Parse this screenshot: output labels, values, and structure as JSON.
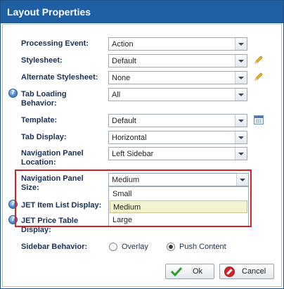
{
  "dialog": {
    "title": "Layout Properties"
  },
  "fields": {
    "processing_event": {
      "label": "Processing Event:",
      "value": "Action"
    },
    "stylesheet": {
      "label": "Stylesheet:",
      "value": "Default"
    },
    "alternate_stylesheet": {
      "label": "Alternate Stylesheet:",
      "value": "None"
    },
    "tab_loading_behavior": {
      "label_line1": "Tab Loading",
      "label_line2": "Behavior:",
      "value": "All"
    },
    "template": {
      "label": "Template:",
      "value": "Default"
    },
    "tab_display": {
      "label": "Tab Display:",
      "value": "Horizontal"
    },
    "navigation_panel_location": {
      "label_line1": "Navigation Panel",
      "label_line2": "Location:",
      "value": "Left Sidebar"
    },
    "navigation_panel_size": {
      "label_line1": "Navigation Panel",
      "label_line2": "Size:",
      "value": "Medium",
      "options": [
        "Small",
        "Medium",
        "Large"
      ],
      "highlighted_option": "Medium"
    },
    "jet_item_list_display": {
      "label": "JET Item List Display:"
    },
    "jet_price_table_display": {
      "label_line1": "JET Price Table",
      "label_line2": "Display:"
    },
    "sidebar_behavior": {
      "label": "Sidebar Behavior:",
      "options": [
        "Overlay",
        "Push Content"
      ],
      "selected": "Push Content"
    }
  },
  "buttons": {
    "ok": "Ok",
    "cancel": "Cancel"
  },
  "icons": {
    "help": "help-icon",
    "edit": "pencil-icon",
    "template_picker": "calendar-icon",
    "ok": "checkmark-icon",
    "cancel": "cancel-icon"
  },
  "colors": {
    "titlebar": "#1f5fa3",
    "highlight_border": "#d1232a",
    "selected_option_bg": "#f4f3cf"
  }
}
